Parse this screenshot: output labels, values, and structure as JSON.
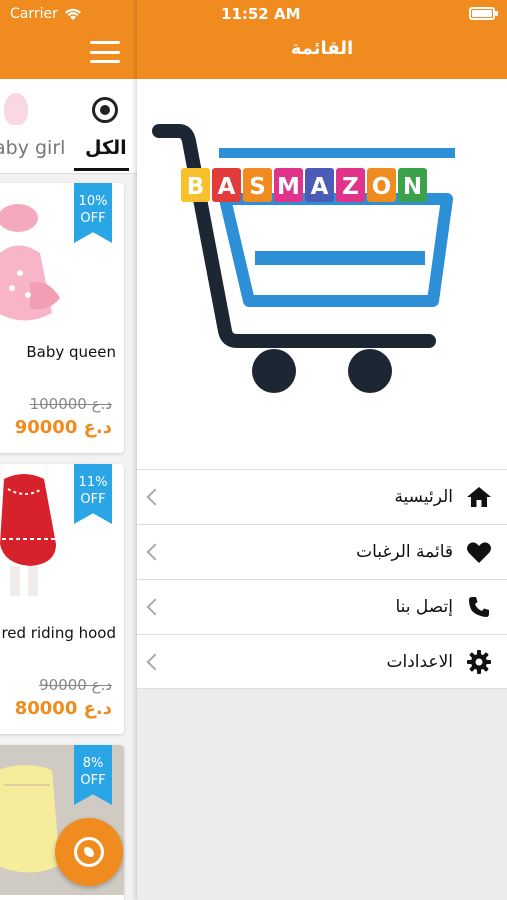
{
  "status_bar": {
    "carrier": "Carrier",
    "time": "11:52 AM"
  },
  "drawer": {
    "title": "القائمة",
    "logo_text": "BASMAZON",
    "menu": [
      {
        "label": "الرئيسية",
        "icon": "home-icon"
      },
      {
        "label": "قائمة الرغبات",
        "icon": "heart-icon"
      },
      {
        "label": "إتصل بنا",
        "icon": "phone-icon"
      },
      {
        "label": "الاعدادات",
        "icon": "gear-icon"
      }
    ]
  },
  "background": {
    "categories": [
      {
        "label": "الكل",
        "active": true
      },
      {
        "label": "aby girl",
        "active": false
      }
    ],
    "products": [
      {
        "name": "Baby queen",
        "discount": "10%\nOFF",
        "old_price": "100000 د.ع",
        "new_price": "90000 د.ع"
      },
      {
        "name": "red riding hood",
        "discount": "11%\nOFF",
        "old_price": "90000 د.ع",
        "new_price": "80000 د.ع"
      },
      {
        "name": "",
        "discount": "8%\nOFF",
        "old_price": "",
        "new_price": ""
      }
    ]
  },
  "colors": {
    "accent": "#f08c1f",
    "badge": "#2aa6e6"
  }
}
